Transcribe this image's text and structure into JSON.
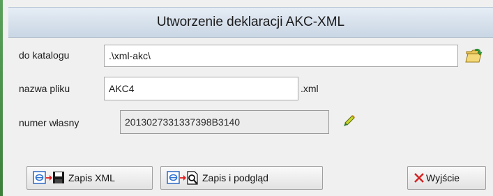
{
  "dialog": {
    "title": "Utworzenie deklaracji AKC-XML"
  },
  "form": {
    "directory": {
      "label": "do katalogu",
      "value": ".\\xml-akc\\"
    },
    "filename": {
      "label": "nazwa pliku",
      "value": "AKC4",
      "extension": ".xml"
    },
    "own_number": {
      "label": "numer własny",
      "value": "2013027331337398B3140"
    }
  },
  "buttons": {
    "save_xml": "Zapis XML",
    "save_preview": "Zapis i podgląd",
    "exit": "Wyjście"
  },
  "icons": {
    "browse": "folder-open-icon",
    "generate": "pencil-icon",
    "save_xml": "xml-to-disk-icon",
    "save_preview": "xml-to-preview-icon",
    "exit": "red-x-icon"
  },
  "colors": {
    "title_bar": "#c9d6e4",
    "window_bg": "#f0f0f0",
    "exit_x": "#d42020"
  }
}
